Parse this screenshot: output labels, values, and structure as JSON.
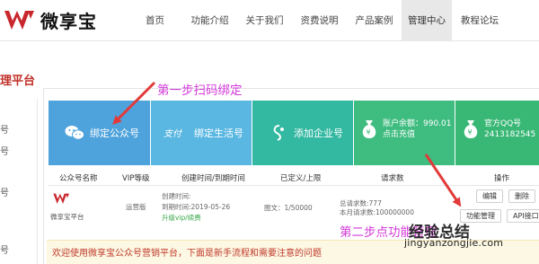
{
  "header": {
    "logo_text": "微享宝",
    "nav": [
      {
        "label": "首页",
        "active": false
      },
      {
        "label": "功能介绍",
        "active": false
      },
      {
        "label": "关于我们",
        "active": false
      },
      {
        "label": "资费说明",
        "active": false
      },
      {
        "label": "产品案例",
        "active": false
      },
      {
        "label": "管理中心",
        "active": true
      },
      {
        "label": "教程论坛",
        "active": false
      }
    ]
  },
  "sidebar": {
    "title": "理平台",
    "glyphs": [
      "号",
      "号",
      "号",
      "号",
      "号",
      "号"
    ]
  },
  "cards": [
    {
      "label": "绑定公众号",
      "icon": "wechat-icon",
      "color": "#4fa3dc"
    },
    {
      "label": "绑定生活号",
      "icon": "alipay-icon",
      "color": "#5ab7e2"
    },
    {
      "label": "添加企业号",
      "icon": "enterprise-icon",
      "color": "#33b8a2"
    },
    {
      "label": "账户余额：990.01",
      "sub": "点击充值",
      "icon": "money-bag-icon",
      "color": "#3fbc80"
    },
    {
      "label": "官方QQ号",
      "sub": "2413182545",
      "icon": "money-bag-icon",
      "color": "#38b775"
    }
  ],
  "table": {
    "headers": [
      "公众号名称",
      "VIP等级",
      "创建时间/到期时间",
      "已定义/上限",
      "请求数",
      "操作"
    ],
    "row": {
      "name": "微享宝平台",
      "vip": "运营版",
      "created_label": "创建时间:",
      "expire": "到期时间:2019-05-26",
      "upgrade": "升级vip/续费",
      "defined": "图文：1/50000",
      "requests_total": "总请求数:777",
      "requests_month": "本月请求数:100000000",
      "actions": [
        "编辑",
        "删除",
        "功能管理",
        "API接口"
      ]
    }
  },
  "notice": "欢迎使用微享宝公众号营销平台，下面是新手流程和需要注意的问题",
  "annotations": {
    "step1": "第一步扫码绑定",
    "step2": "第二步点功能管理",
    "watermark": "经验总结",
    "watermark_url": "jingyanzongjie.com"
  },
  "colors": {
    "brand_red": "#c9272d",
    "annotation": "#d33ad9",
    "arrow": "#e23a3a"
  }
}
